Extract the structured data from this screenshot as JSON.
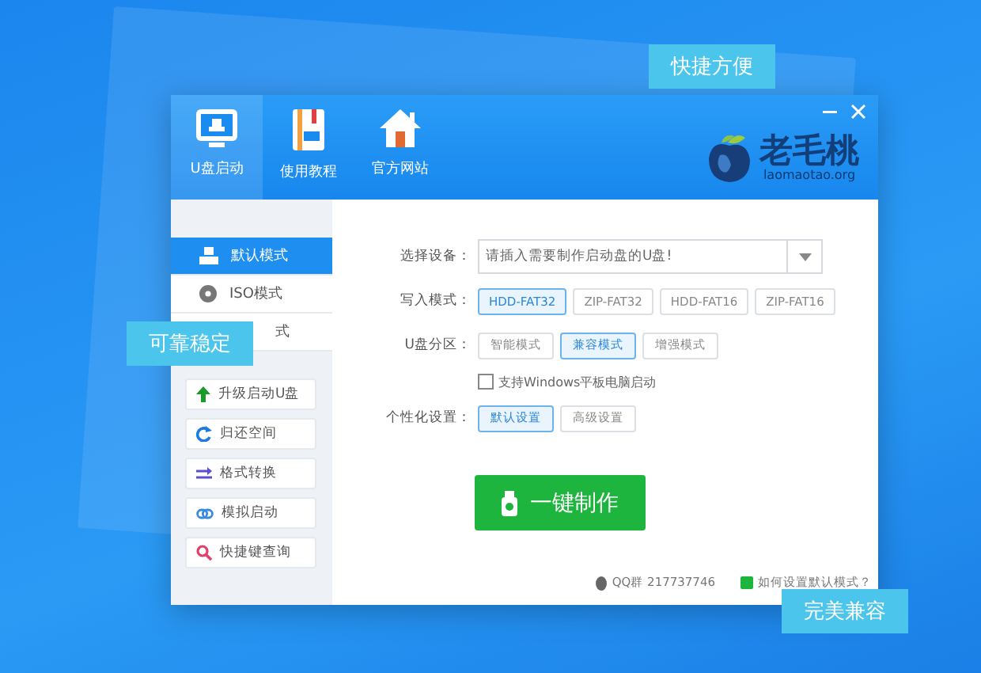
{
  "nav": [
    {
      "label": "U盘启动",
      "kind": "monitor",
      "selected": true
    },
    {
      "label": "使用教程",
      "kind": "book",
      "selected": false
    },
    {
      "label": "官方网站",
      "kind": "home",
      "selected": false
    }
  ],
  "logo": {
    "name": "老毛桃",
    "domain": "laomaotao.org"
  },
  "sidebar": {
    "modes": [
      {
        "label": "默认模式",
        "kind": "user",
        "selected": true
      },
      {
        "label": "ISO模式",
        "kind": "disc",
        "selected": false
      },
      {
        "label": "式",
        "kind": "hidden",
        "selected": false
      }
    ],
    "tools": [
      {
        "label": "升级启动U盘",
        "kind": "upgrade"
      },
      {
        "label": "归还空间",
        "kind": "restore"
      },
      {
        "label": "格式转换",
        "kind": "convert"
      },
      {
        "label": "模拟启动",
        "kind": "link"
      },
      {
        "label": "快捷键查询",
        "kind": "search"
      }
    ]
  },
  "form": {
    "device": {
      "label": "选择设备：",
      "placeholder": "请插入需要制作启动盘的U盘!"
    },
    "write_mode": {
      "label": "写入模式：",
      "options": [
        {
          "label": "HDD-FAT32",
          "selected": true
        },
        {
          "label": "ZIP-FAT32",
          "selected": false
        },
        {
          "label": "HDD-FAT16",
          "selected": false
        },
        {
          "label": "ZIP-FAT16",
          "selected": false
        }
      ]
    },
    "partition": {
      "label": "U盘分区：",
      "options": [
        {
          "label": "智能模式",
          "selected": false
        },
        {
          "label": "兼容模式",
          "selected": true
        },
        {
          "label": "增强模式",
          "selected": false
        }
      ]
    },
    "tablet": {
      "label": "支持Windows平板电脑启动",
      "checked": false
    },
    "personalize": {
      "label": "个性化设置：",
      "options": [
        {
          "label": "默认设置",
          "selected": true
        },
        {
          "label": "高级设置",
          "selected": false
        }
      ]
    }
  },
  "make_button": "一键制作",
  "footer": {
    "qq": "QQ群 217737746",
    "help": "如何设置默认模式？"
  },
  "badges": [
    "快捷方便",
    "可靠稳定",
    "完美兼容"
  ]
}
